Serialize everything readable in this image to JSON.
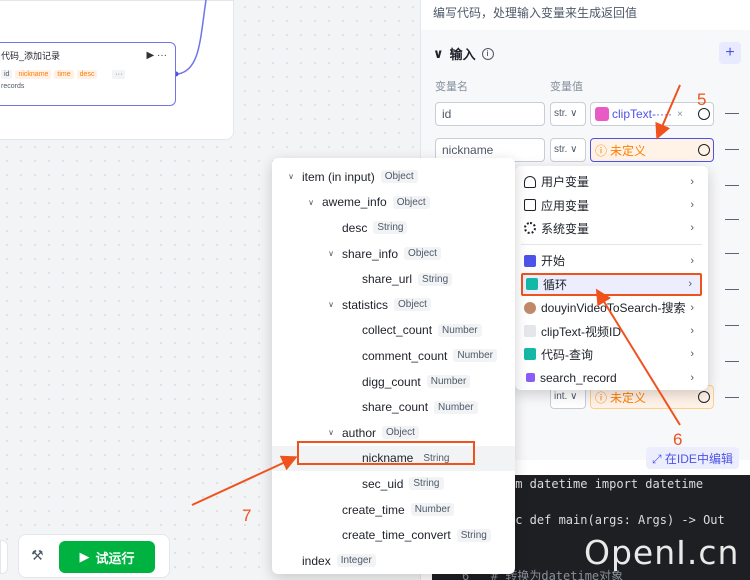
{
  "canvas": {
    "node_title": "代码_添加记录",
    "node_acts": "▶ ···",
    "input_chips": [
      "id",
      "nickname",
      "time",
      "desc"
    ],
    "more_chip": "···",
    "output_label": "records"
  },
  "panel": {
    "description": "编写代码，处理输入变量来生成返回值",
    "section_title": "输入",
    "info_glyph": "i",
    "add_glyph": "+",
    "col_name": "变量名",
    "col_value": "变量值",
    "rows": [
      {
        "name": "id",
        "type": "str.",
        "value": "clipText-····",
        "clear": "×"
      },
      {
        "name": "nickname",
        "type": "str.",
        "value": "未定义"
      }
    ],
    "last_row": {
      "type": "int.",
      "value": "未定义"
    },
    "undef_glyph": "ⓘ",
    "minus_glyph": "—",
    "ide_button": "⤢ 在IDE中编辑"
  },
  "dropdown": {
    "items": [
      {
        "label": "用户变量",
        "icon": "user-icon"
      },
      {
        "label": "应用变量",
        "icon": "folder-icon"
      },
      {
        "label": "系统变量",
        "icon": "gear-icon"
      }
    ],
    "nodes": [
      {
        "label": "开始",
        "icon": "start-icon",
        "color": "#4d53e8"
      },
      {
        "label": "循环",
        "icon": "loop-icon",
        "color": "#14b8a6"
      },
      {
        "label": "douyinVideoToSearch-搜索",
        "icon": "avatar-icon",
        "color": "#c08a6a"
      },
      {
        "label": "clipText-视频ID",
        "icon": "audio-icon",
        "color": "#8a8f99"
      },
      {
        "label": "代码-查询",
        "icon": "code-icon",
        "color": "#14b8a6"
      },
      {
        "label": "search_record",
        "icon": "db-icon",
        "color": "#8b5cf6"
      }
    ],
    "chevron": "›"
  },
  "tree": {
    "rows": [
      {
        "label": "item (in input)",
        "type": "Object",
        "depth": 0,
        "caret": "∨"
      },
      {
        "label": "aweme_info",
        "type": "Object",
        "depth": 1,
        "caret": "∨"
      },
      {
        "label": "desc",
        "type": "String",
        "depth": 2,
        "caret": ""
      },
      {
        "label": "share_info",
        "type": "Object",
        "depth": 2,
        "caret": "∨"
      },
      {
        "label": "share_url",
        "type": "String",
        "depth": 3,
        "caret": ""
      },
      {
        "label": "statistics",
        "type": "Object",
        "depth": 2,
        "caret": "∨"
      },
      {
        "label": "collect_count",
        "type": "Number",
        "depth": 3,
        "caret": ""
      },
      {
        "label": "comment_count",
        "type": "Number",
        "depth": 3,
        "caret": ""
      },
      {
        "label": "digg_count",
        "type": "Number",
        "depth": 3,
        "caret": ""
      },
      {
        "label": "share_count",
        "type": "Number",
        "depth": 3,
        "caret": ""
      },
      {
        "label": "author",
        "type": "Object",
        "depth": 2,
        "caret": "∨"
      },
      {
        "label": "nickname",
        "type": "String",
        "depth": 3,
        "caret": "",
        "selected": true
      },
      {
        "label": "sec_uid",
        "type": "String",
        "depth": 3,
        "caret": ""
      },
      {
        "label": "create_time",
        "type": "Number",
        "depth": 2,
        "caret": ""
      },
      {
        "label": "create_time_convert",
        "type": "String",
        "depth": 2,
        "caret": ""
      },
      {
        "label": "index",
        "type": "Integer",
        "depth": 0,
        "caret": ""
      }
    ]
  },
  "code": {
    "line1": "om datetime import datetime",
    "line2": "nc def main(args: Args) -> Out",
    "line3": "6   # 转换为datetime对象"
  },
  "toolbar": {
    "tool_glyph": "⚒",
    "run_label": "试运行",
    "run_glyph": "▶"
  },
  "annotations": {
    "five": "5",
    "six": "6",
    "seven": "7"
  },
  "watermark": "OpenI.cn"
}
